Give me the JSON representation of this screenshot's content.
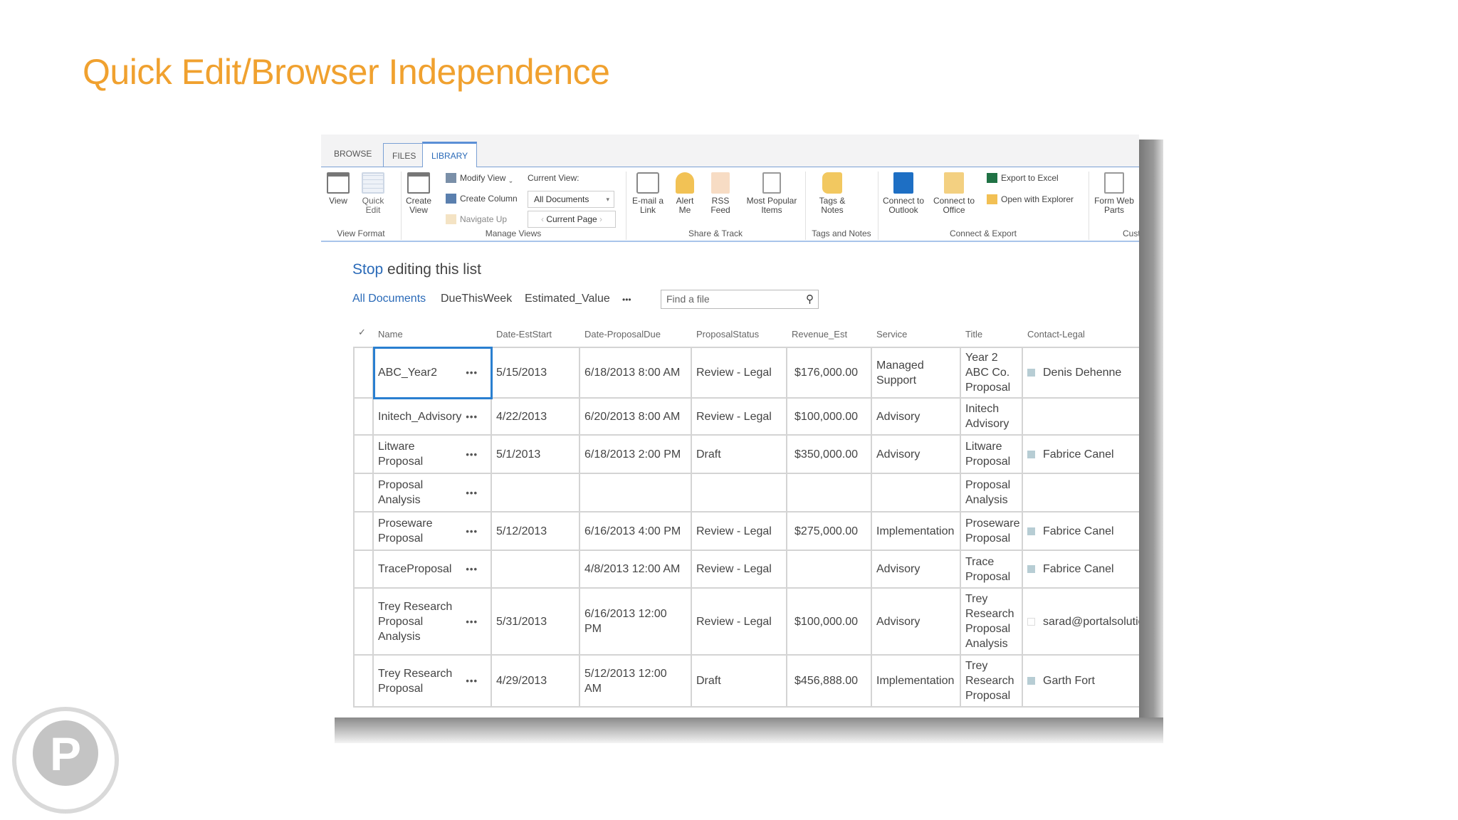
{
  "slide_title": "Quick Edit/Browser Independence",
  "tabs": [
    "BROWSE",
    "FILES",
    "LIBRARY"
  ],
  "ribbon": {
    "view": "View",
    "quick_edit": "Quick Edit",
    "create_view": "Create View",
    "modify_view": "Modify View",
    "create_column": "Create Column",
    "navigate_up": "Navigate Up",
    "current_view_label": "Current View:",
    "current_view_value": "All Documents",
    "current_page": "Current Page",
    "email_link": "E-mail a Link",
    "alert_me": "Alert Me",
    "rss_feed": "RSS Feed",
    "most_popular": "Most Popular Items",
    "tags_notes": "Tags & Notes",
    "connect_outlook": "Connect to Outlook",
    "connect_office": "Connect to Office",
    "export_excel": "Export to Excel",
    "open_explorer": "Open with Explorer",
    "form_web_parts": "Form Web Parts",
    "groups": [
      "View Format",
      "Manage Views",
      "Share & Track",
      "Tags and Notes",
      "Connect & Export",
      "Cust"
    ]
  },
  "stop_editing": {
    "link": "Stop",
    "rest": "editing this list"
  },
  "views": [
    "All Documents",
    "DueThisWeek",
    "Estimated_Value",
    "•••"
  ],
  "search": {
    "placeholder": "Find a file"
  },
  "columns": [
    "Name",
    "Date-EstStart",
    "Date-ProposalDue",
    "ProposalStatus",
    "Revenue_Est",
    "Service",
    "Title",
    "Contact-Legal"
  ],
  "rows": [
    {
      "name": "ABC_Year2",
      "start": "5/15/2013",
      "due": "6/18/2013 8:00 AM",
      "status": "Review - Legal",
      "revenue": "$176,000.00",
      "service": "Managed Support",
      "title": "Year 2 ABC Co. Proposal",
      "contact": "Denis Dehenne"
    },
    {
      "name": "Initech_Advisory",
      "start": "4/22/2013",
      "due": "6/20/2013 8:00 AM",
      "status": "Review - Legal",
      "revenue": "$100,000.00",
      "service": "Advisory",
      "title": "Initech Advisory",
      "contact": ""
    },
    {
      "name": "Litware Proposal",
      "start": "5/1/2013",
      "due": "6/18/2013 2:00 PM",
      "status": "Draft",
      "revenue": "$350,000.00",
      "service": "Advisory",
      "title": "Litware Proposal",
      "contact": "Fabrice Canel"
    },
    {
      "name": "Proposal Analysis",
      "start": "",
      "due": "",
      "status": "",
      "revenue": "",
      "service": "",
      "title": "Proposal Analysis",
      "contact": ""
    },
    {
      "name": "Proseware Proposal",
      "start": "5/12/2013",
      "due": "6/16/2013 4:00 PM",
      "status": "Review - Legal",
      "revenue": "$275,000.00",
      "service": "Implementation",
      "title": "Proseware Proposal",
      "contact": "Fabrice Canel"
    },
    {
      "name": "TraceProposal",
      "start": "",
      "due": "4/8/2013 12:00 AM",
      "status": "Review - Legal",
      "revenue": "",
      "service": "Advisory",
      "title": "Trace Proposal",
      "contact": "Fabrice Canel"
    },
    {
      "name": "Trey Research Proposal Analysis",
      "start": "5/31/2013",
      "due": "6/16/2013 12:00 PM",
      "status": "Review - Legal",
      "revenue": "$100,000.00",
      "service": "Advisory",
      "title": "Trey Research Proposal Analysis",
      "contact": "sarad@portalsolutions"
    },
    {
      "name": "Trey Research Proposal",
      "start": "4/29/2013",
      "due": "5/12/2013 12:00 AM",
      "status": "Draft",
      "revenue": "$456,888.00",
      "service": "Implementation",
      "title": "Trey Research Proposal",
      "contact": "Garth Fort"
    }
  ],
  "colors": {
    "accent_orange": "#f0a12f",
    "link_blue": "#2a6ab8",
    "selection_blue": "#2a7fd0"
  },
  "logo_letter": "P"
}
